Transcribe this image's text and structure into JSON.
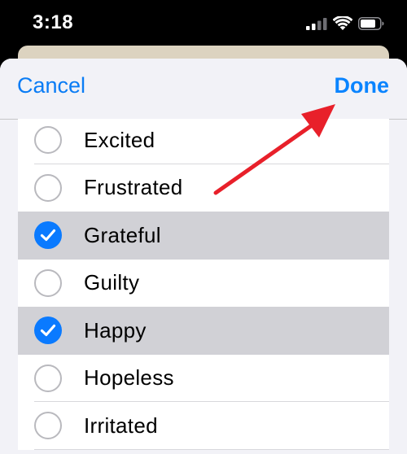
{
  "status_bar": {
    "time": "3:18",
    "icons": [
      "cellular-signal-icon",
      "wifi-icon",
      "battery-icon"
    ]
  },
  "sheet": {
    "cancel_label": "Cancel",
    "done_label": "Done"
  },
  "emotions": [
    {
      "label": "Excited",
      "selected": false
    },
    {
      "label": "Frustrated",
      "selected": false
    },
    {
      "label": "Grateful",
      "selected": true
    },
    {
      "label": "Guilty",
      "selected": false
    },
    {
      "label": "Happy",
      "selected": true
    },
    {
      "label": "Hopeless",
      "selected": false
    },
    {
      "label": "Irritated",
      "selected": false
    }
  ],
  "colors": {
    "accent": "#0a84ff",
    "selected_row": "#d1d1d6",
    "annotation_arrow": "#e8202a"
  }
}
